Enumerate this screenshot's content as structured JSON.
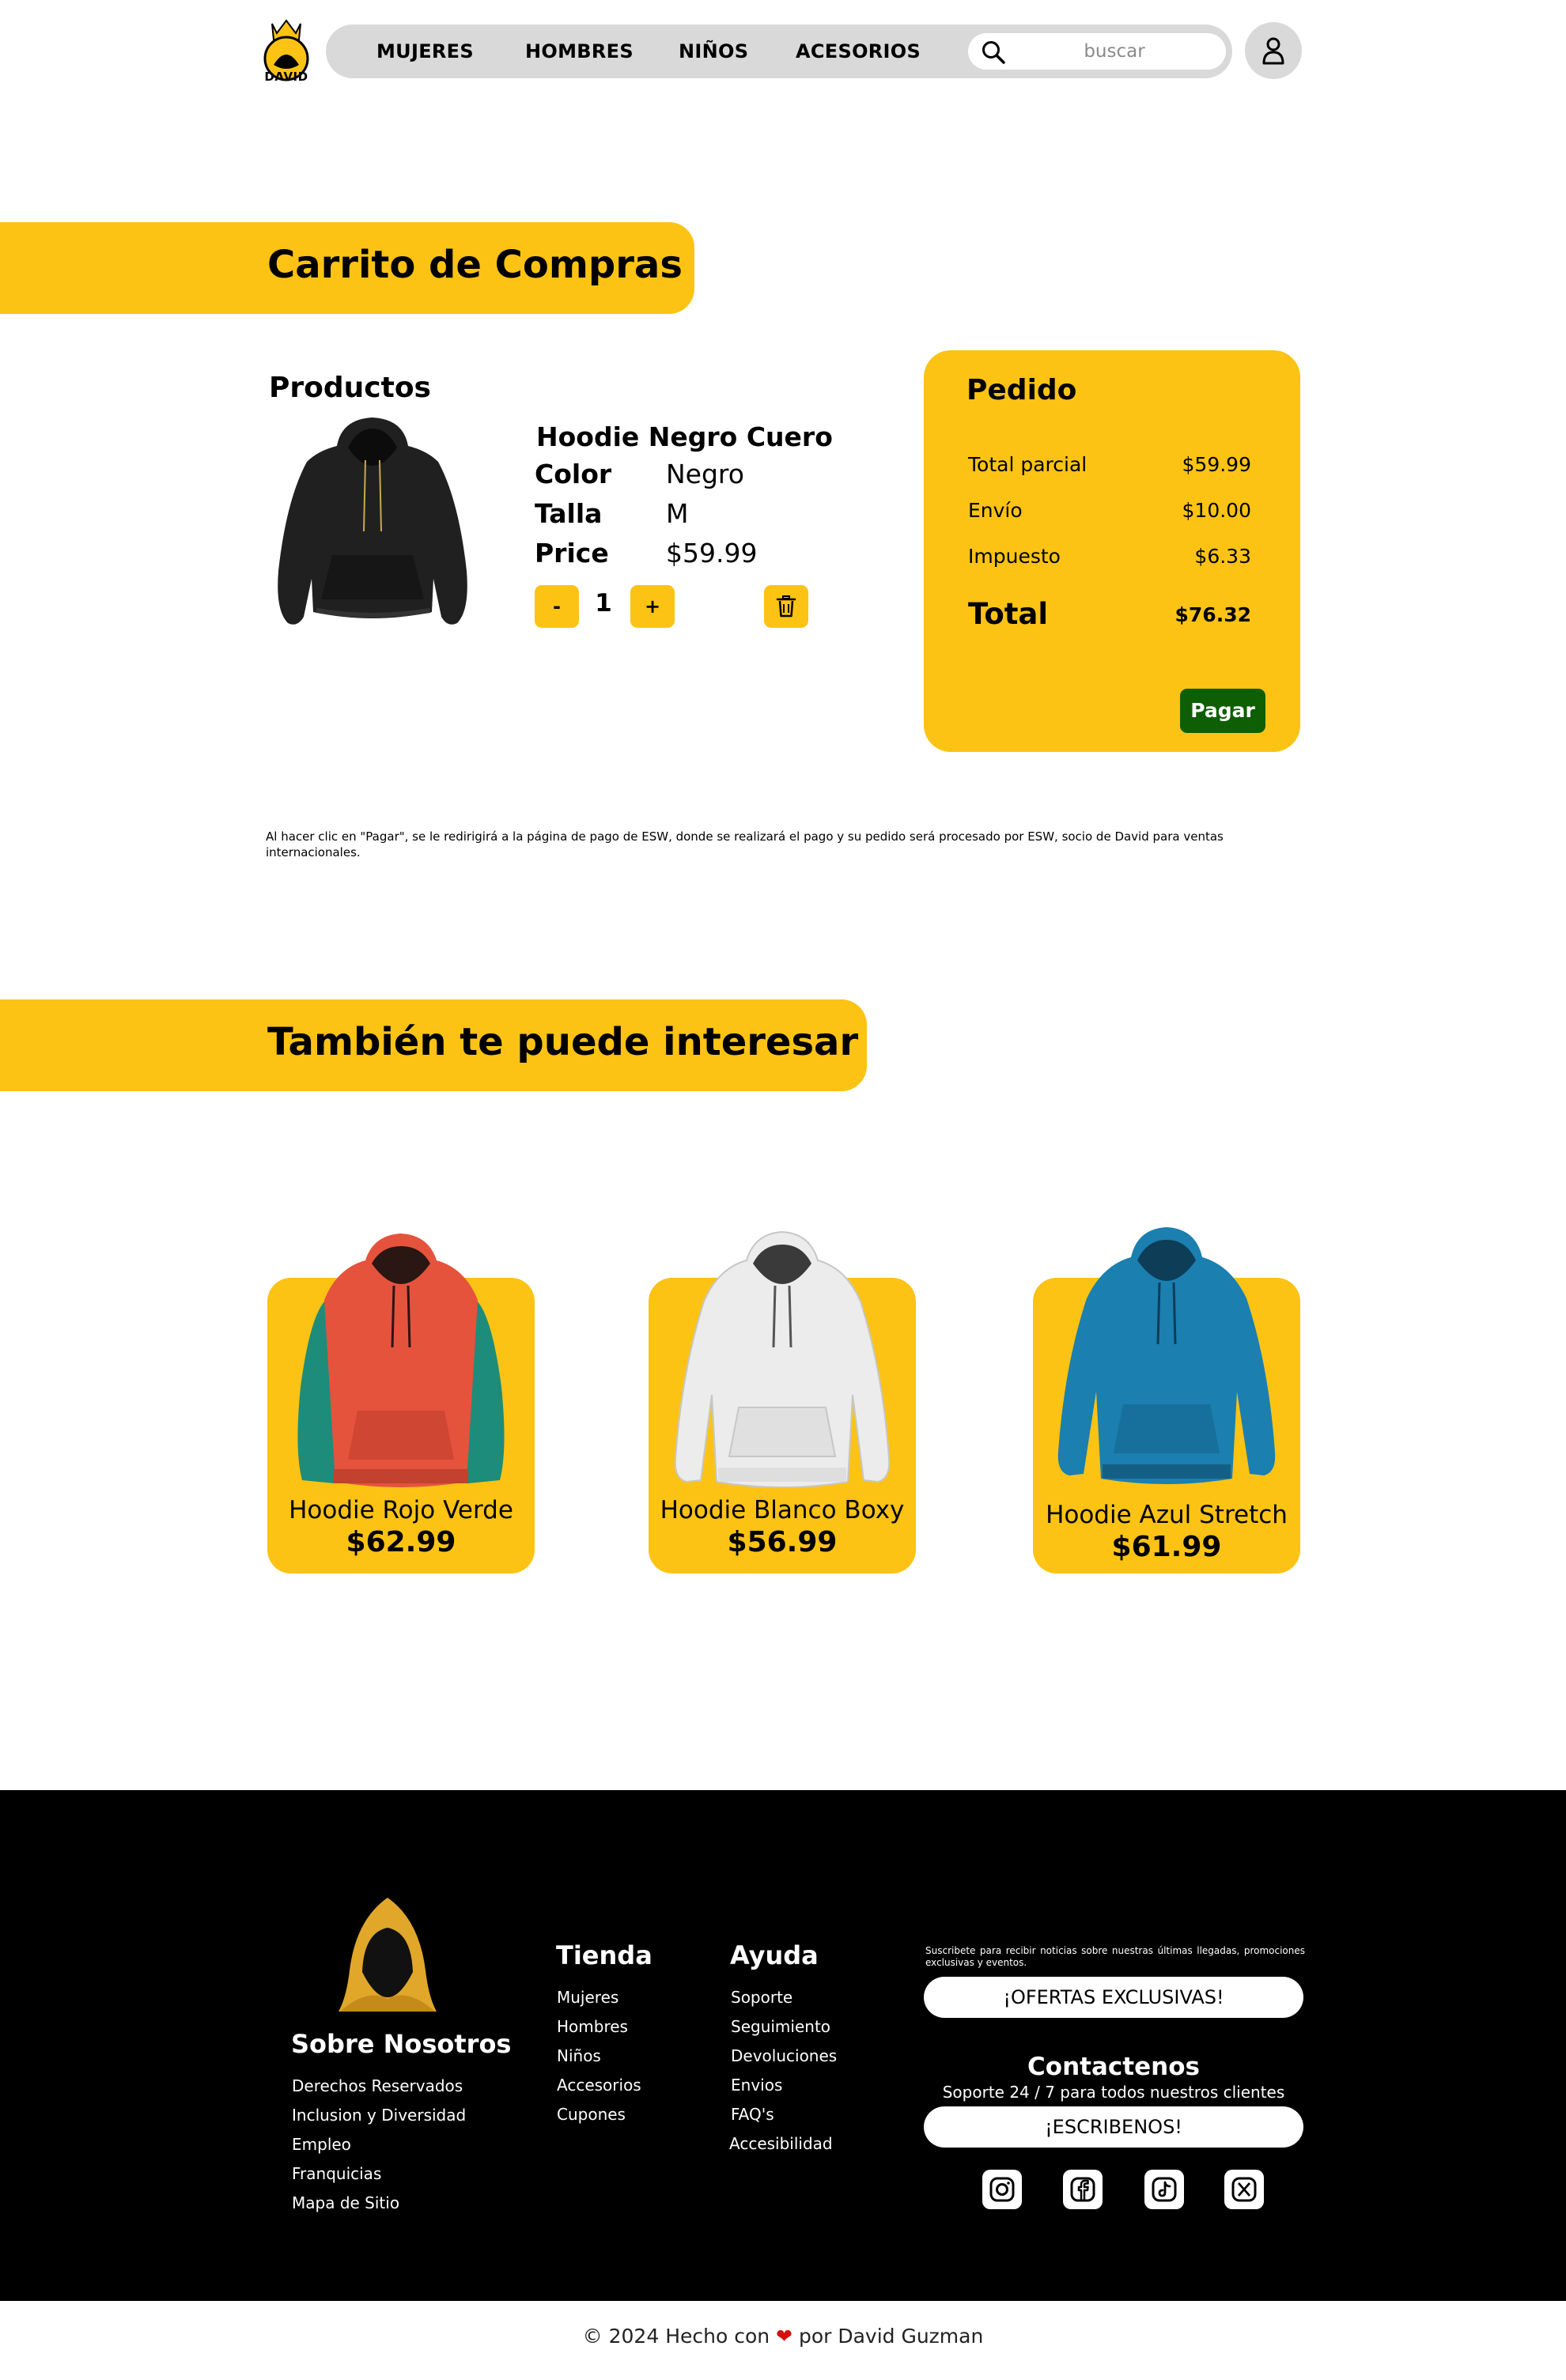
{
  "header": {
    "logo_text": "DAVID",
    "nav": [
      "MUJERES",
      "HOMBRES",
      "NIÑOS",
      "ACESORIOS"
    ],
    "search_placeholder": "buscar"
  },
  "cart": {
    "title": "Carrito de Compras",
    "products_heading": "Productos",
    "item": {
      "name": "Hoodie Negro Cuero",
      "color_label": "Color",
      "color_value": "Negro",
      "size_label": "Talla",
      "size_value": "M",
      "price_label": "Price",
      "price_value": "$59.99",
      "quantity": "1",
      "minus": "-",
      "plus": "+"
    },
    "order": {
      "title": "Pedido",
      "subtotal_label": "Total parcial",
      "subtotal_value": "$59.99",
      "shipping_label": "Envío",
      "shipping_value": "$10.00",
      "tax_label": "Impuesto",
      "tax_value": "$6.33",
      "total_label": "Total",
      "total_value": "$76.32",
      "pay_button": "Pagar"
    },
    "disclaimer": "Al hacer clic en \"Pagar\", se le redirigirá a la página de pago de ESW, donde se realizará el pago y su pedido será procesado por ESW, socio de David para ventas internacionales."
  },
  "recommendations": {
    "title": "También te puede interesar",
    "items": [
      {
        "name": "Hoodie Rojo Verde",
        "price": "$62.99"
      },
      {
        "name": "Hoodie Blanco Boxy",
        "price": "$56.99"
      },
      {
        "name": "Hoodie Azul Stretch",
        "price": "$61.99"
      }
    ]
  },
  "footer": {
    "about": {
      "heading": "Sobre Nosotros",
      "links": [
        "Derechos Reservados",
        "Inclusion y Diversidad",
        "Empleo",
        "Franquicias",
        "Mapa de Sitio"
      ]
    },
    "store": {
      "heading": "Tienda",
      "links": [
        "Mujeres",
        "Hombres",
        "Niños",
        "Accesorios",
        "Cupones"
      ]
    },
    "help": {
      "heading": "Ayuda",
      "links": [
        "Soporte",
        "Seguimiento",
        "Devoluciones",
        "Envios",
        "FAQ's",
        "Accesibilidad"
      ]
    },
    "newsletter_text": "Suscribete para recibir noticias sobre nuestras últimas llegadas, promociones exclusivas y eventos.",
    "offers_button": "¡OFERTAS EXCLUSIVAS!",
    "contact_heading": "Contactenos",
    "support_text": "Soporte 24 / 7 para todos nuestros clientes",
    "write_button": "¡ESCRIBENOS!",
    "socials": [
      "instagram-icon",
      "facebook-icon",
      "tiktok-icon",
      "x-icon"
    ]
  },
  "copyright": {
    "prefix": "© 2024 Hecho con",
    "suffix": "por David Guzman"
  },
  "colors": {
    "accent": "#fcc314",
    "pay_button": "#0e5e04",
    "footer_bg": "#000000",
    "nav_bg": "#d9d9d9",
    "heart": "#d40f0f"
  }
}
